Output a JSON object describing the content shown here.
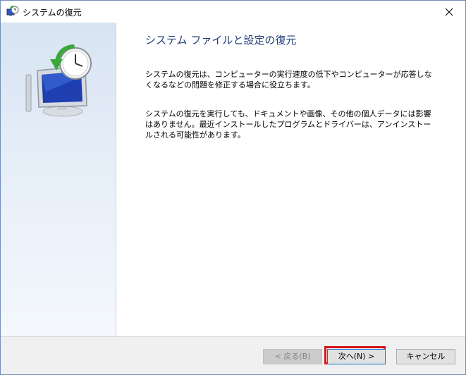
{
  "window": {
    "title": "システムの復元"
  },
  "content": {
    "heading": "システム ファイルと設定の復元",
    "paragraph1": "システムの復元は、コンピューターの実行速度の低下やコンピューターが応答しなくなるなどの問題を修正する場合に役立ちます。",
    "paragraph2": "システムの復元を実行しても、ドキュメントや画像、その他の個人データには影響はありません。最近インストールしたプログラムとドライバーは、アンインストールされる可能性があります。"
  },
  "buttons": {
    "back_label": "< 戻る(B)",
    "next_label": "次へ(N) >",
    "cancel_label": "キャンセル"
  },
  "icons": {
    "title": "system-restore-icon",
    "hero": "computer-clock-restore-icon",
    "close": "close-icon"
  },
  "colors": {
    "heading": "#1f3f7a",
    "highlight": "#d9141c",
    "focus_border": "#0078d7"
  }
}
